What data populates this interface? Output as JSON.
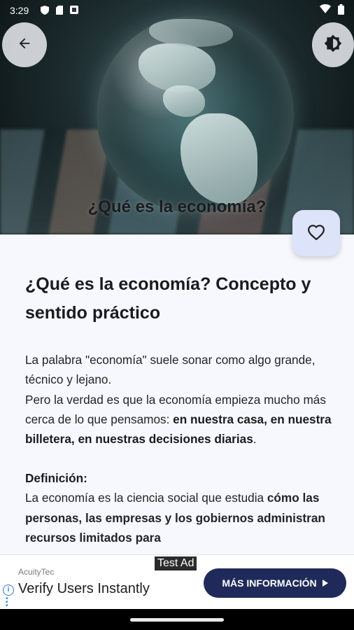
{
  "status_bar": {
    "time": "3:29",
    "left_icons": [
      "shield-icon",
      "sim-icon",
      "app-icon"
    ],
    "right_icons": [
      "wifi-icon",
      "battery-icon"
    ]
  },
  "hero": {
    "caption": "¿Qué es la economía?"
  },
  "article": {
    "title": "¿Qué es la economía? Concepto y sentido práctico",
    "p1_text": "La palabra \"economía\" suele sonar como algo grande, técnico y lejano.",
    "p2_text": "Pero la verdad es que la economía empieza mucho más cerca de lo que pensamos: ",
    "p2_bold": "en nuestra casa, en nuestra billetera, en nuestras decisiones diarias",
    "p2_end": ".",
    "definition_label": "Definición:",
    "definition_text": "La economía es la ciencia social que estudia ",
    "definition_bold": "cómo las personas, las empresas y los gobiernos administran recursos limitados para"
  },
  "ad": {
    "badge": "Test Ad",
    "advertiser": "AcuityTec",
    "headline": "Verify Users Instantly",
    "cta_label": "MÁS INFORMACIÓN"
  },
  "colors": {
    "background": "#f7f8fd",
    "fab_background": "#dde3f8",
    "cta_background": "#1f2a5a"
  }
}
